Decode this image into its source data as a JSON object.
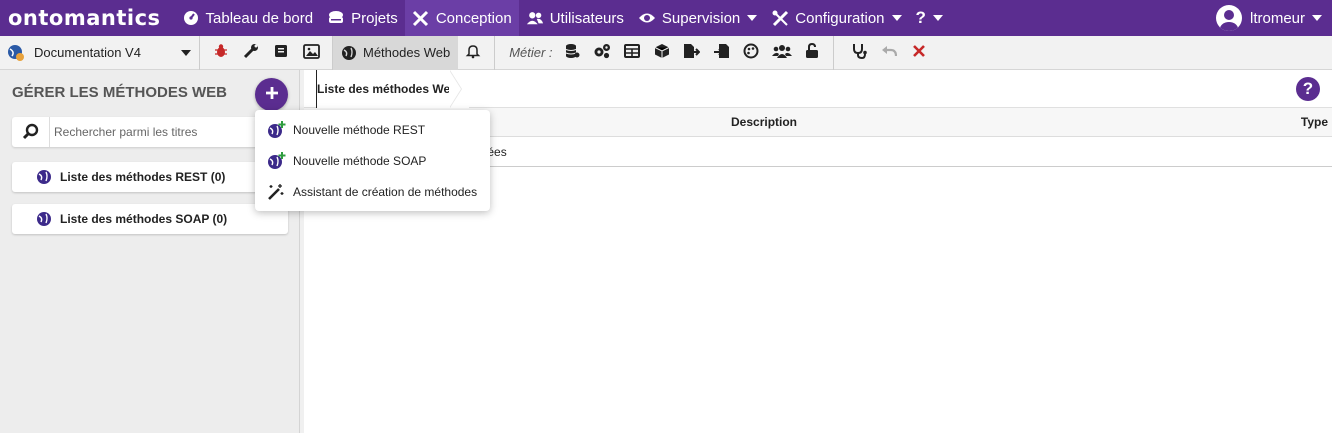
{
  "nav": {
    "logo": "ontomantics",
    "items": [
      {
        "label": "Tableau de bord"
      },
      {
        "label": "Projets"
      },
      {
        "label": "Conception"
      },
      {
        "label": "Utilisateurs"
      },
      {
        "label": "Supervision"
      },
      {
        "label": "Configuration"
      },
      {
        "label": "?"
      }
    ],
    "user": "ltromeur",
    "accent": "#5b2d90"
  },
  "toolbar": {
    "project": "Documentation V4",
    "active_tab": "Méthodes Web",
    "metier_label": "Métier :"
  },
  "left": {
    "title": "GÉRER LES MÉTHODES WEB",
    "search_placeholder": "Rechercher parmi les titres",
    "lists": [
      {
        "label": "Liste des méthodes REST (0)"
      },
      {
        "label": "Liste des méthodes SOAP (0)"
      }
    ]
  },
  "main": {
    "breadcrumb": "Liste des méthodes Web",
    "columns": {
      "description": "Description",
      "type": "Type"
    },
    "row_text": "nnées"
  },
  "menu": {
    "items": [
      {
        "label": "Nouvelle méthode REST"
      },
      {
        "label": "Nouvelle méthode SOAP"
      },
      {
        "label": "Assistant de création de méthodes"
      }
    ]
  }
}
